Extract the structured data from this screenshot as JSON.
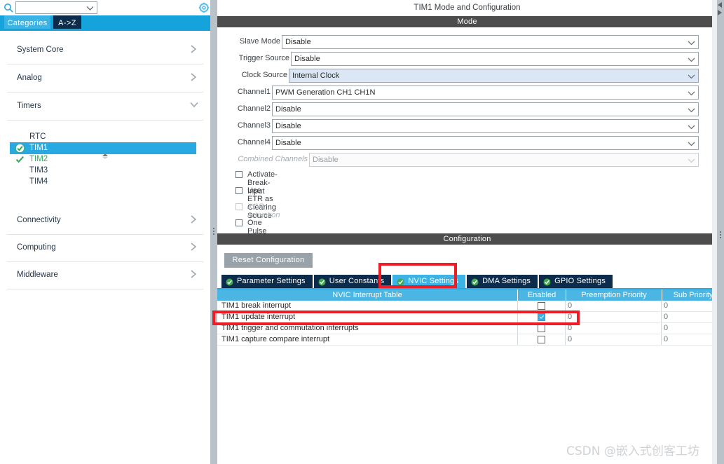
{
  "sidebar": {
    "search": {
      "placeholder": "",
      "value": "",
      "icon": "search-icon"
    },
    "gear_icon": "gear-icon",
    "tabs": [
      {
        "label": "Categories",
        "active": true
      },
      {
        "label": "A->Z",
        "active": false
      }
    ],
    "categories": [
      {
        "label": "System Core",
        "expanded": false
      },
      {
        "label": "Analog",
        "expanded": false
      },
      {
        "label": "Timers",
        "expanded": true
      },
      {
        "label": "Connectivity",
        "expanded": false
      },
      {
        "label": "Computing",
        "expanded": false
      },
      {
        "label": "Middleware",
        "expanded": false
      }
    ],
    "timer_items": [
      {
        "label": "RTC",
        "state": "none"
      },
      {
        "label": "TIM1",
        "state": "selected-configured"
      },
      {
        "label": "TIM2",
        "state": "configured"
      },
      {
        "label": "TIM3",
        "state": "none"
      },
      {
        "label": "TIM4",
        "state": "none"
      }
    ]
  },
  "main": {
    "title": "TIM1 Mode and Configuration",
    "mode_section_title": "Mode",
    "config_section_title": "Configuration",
    "mode_fields": [
      {
        "label": "Slave Mode",
        "value": "Disable",
        "state": "normal"
      },
      {
        "label": "Trigger Source",
        "value": "Disable",
        "state": "normal"
      },
      {
        "label": "Clock Source",
        "value": "Internal Clock",
        "state": "highlight"
      },
      {
        "label": "Channel1",
        "value": "PWM Generation CH1 CH1N",
        "state": "normal"
      },
      {
        "label": "Channel2",
        "value": "Disable",
        "state": "normal"
      },
      {
        "label": "Channel3",
        "value": "Disable",
        "state": "normal"
      },
      {
        "label": "Channel4",
        "value": "Disable",
        "state": "normal"
      },
      {
        "label": "Combined Channels",
        "value": "Disable",
        "state": "disabled"
      }
    ],
    "mode_checkboxes": [
      {
        "label": "Activate-Break-Input",
        "checked": false,
        "disabled": false
      },
      {
        "label": "Use ETR as Clearing Source",
        "checked": false,
        "disabled": false
      },
      {
        "label": "XOR activation",
        "checked": false,
        "disabled": true
      },
      {
        "label": "One Pulse Mode",
        "checked": false,
        "disabled": false
      }
    ],
    "reset_button": "Reset Configuration",
    "config_tabs": [
      {
        "label": "Parameter Settings",
        "active": false
      },
      {
        "label": "User Constants",
        "active": false
      },
      {
        "label": "NVIC Settings",
        "active": true
      },
      {
        "label": "DMA Settings",
        "active": false
      },
      {
        "label": "GPIO Settings",
        "active": false
      }
    ],
    "nvic_table": {
      "headers": [
        "NVIC Interrupt Table",
        "Enabled",
        "Preemption Priority",
        "Sub Priority"
      ],
      "rows": [
        {
          "name": "TIM1 break interrupt",
          "enabled": false,
          "preemption": "0",
          "sub": "0"
        },
        {
          "name": "TIM1 update interrupt",
          "enabled": true,
          "preemption": "0",
          "sub": "0"
        },
        {
          "name": "TIM1 trigger and commutation interrupts",
          "enabled": false,
          "preemption": "0",
          "sub": "0"
        },
        {
          "name": "TIM1 capture compare interrupt",
          "enabled": false,
          "preemption": "0",
          "sub": "0"
        }
      ]
    }
  },
  "watermark": "CSDN @嵌入式创客工坊",
  "colors": {
    "accent_blue": "#29a9e1",
    "tab_navy": "#0d2b4a",
    "header_blue": "#4bb5e3",
    "section_gray": "#4d4d4d",
    "annotation_red": "#ee1c25",
    "highlight_field": "#dbe7f4",
    "configured_green": "#2faa59"
  }
}
